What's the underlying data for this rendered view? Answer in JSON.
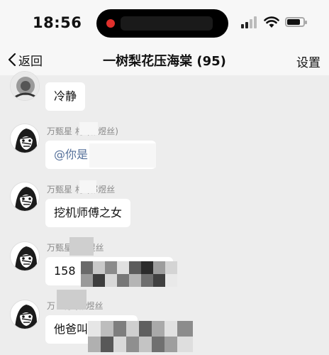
{
  "status": {
    "time": "18:56"
  },
  "nav": {
    "back_label": "返回",
    "title": "一树梨花压海棠 (95)",
    "settings_label": "设置"
  },
  "messages": [
    {
      "sender": "",
      "text": "冷静"
    },
    {
      "sender": "万甄星 村 (祁煜丝)",
      "text": "@你是"
    },
    {
      "sender": "万甄星 村 (祁煜丝",
      "text": "挖机师傅之女"
    },
    {
      "sender": "万甄星 (祁煜丝",
      "text": "158"
    },
    {
      "sender": "万 P村 (祁煜丝",
      "text": "他爸叫"
    }
  ]
}
